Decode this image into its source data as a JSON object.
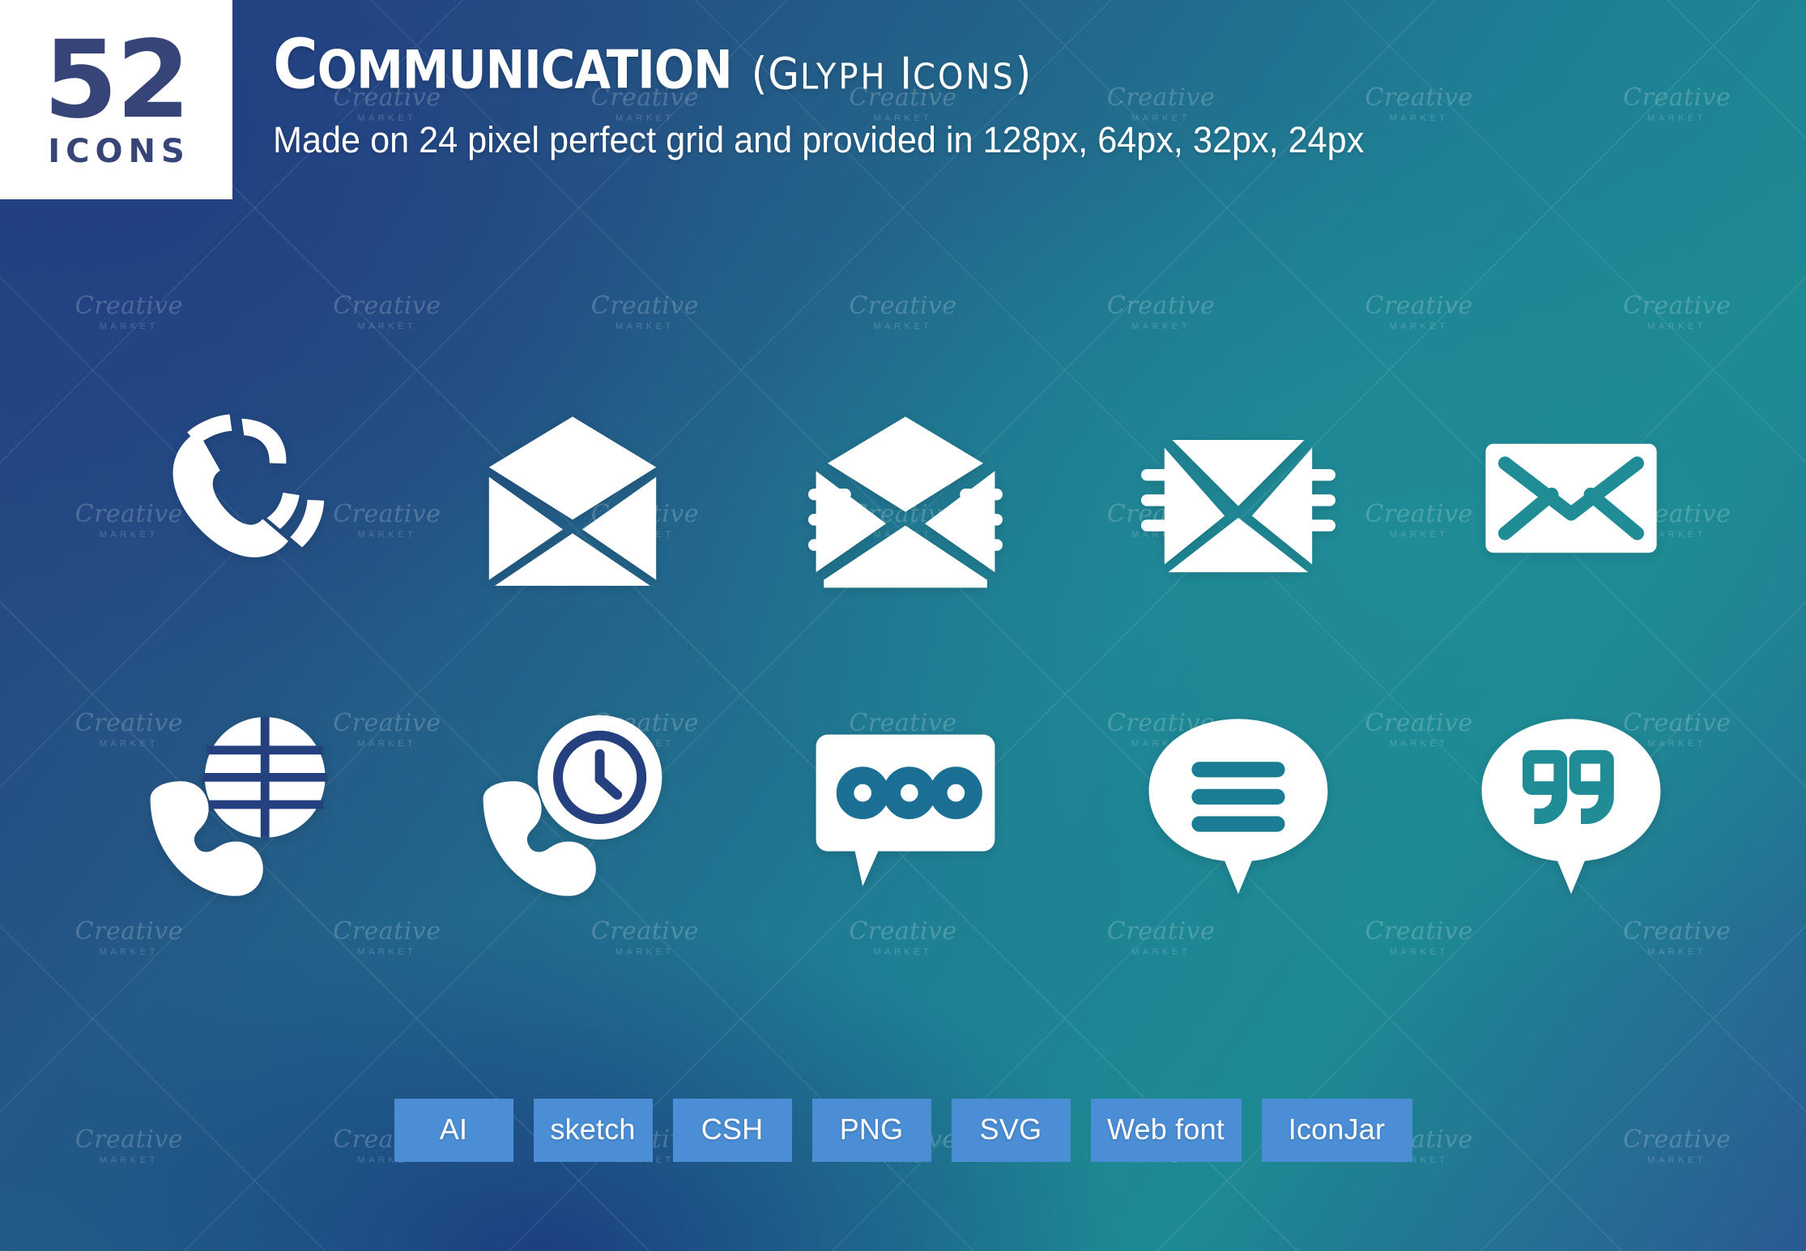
{
  "badge": {
    "count": "52",
    "label": "ICONS"
  },
  "header": {
    "title_lead": "C",
    "title_rest": "OMMUNICATION",
    "title_paren_open": "(",
    "title_glyph_lead": "G",
    "title_glyph_rest": "LYPH",
    "title_icons_lead": "I",
    "title_icons_rest": "CONS",
    "title_paren_close": ")",
    "title_full": "Communication (Glyph Icons)",
    "subtitle": "Made on 24 pixel perfect grid and provided in 128px, 64px, 32px, 24px"
  },
  "watermark": {
    "top": "Creative",
    "bottom": "MARKET"
  },
  "colors": {
    "badge_text": "#374477",
    "badge_bg": "#ffffff",
    "icon_fill": "#ffffff",
    "format_chip": "#4b8ed6",
    "bg_blue": "#24407f",
    "bg_teal": "#1f8c96"
  },
  "icons": [
    {
      "name": "phone-handset-icon",
      "label": "Phone call"
    },
    {
      "name": "envelope-open-icon",
      "label": "Open envelope"
    },
    {
      "name": "envelope-open-lines-icon",
      "label": "Open envelope with message lines"
    },
    {
      "name": "envelope-closed-lines-icon",
      "label": "Closed envelope with message lines"
    },
    {
      "name": "envelope-closed-icon",
      "label": "Closed envelope"
    },
    {
      "name": "phone-globe-icon",
      "label": "International call"
    },
    {
      "name": "phone-clock-icon",
      "label": "Call time"
    },
    {
      "name": "chat-bubble-dots-icon",
      "label": "Chat typing bubble"
    },
    {
      "name": "chat-bubble-lines-icon",
      "label": "Chat message bubble"
    },
    {
      "name": "chat-bubble-quote-icon",
      "label": "Quote bubble"
    }
  ],
  "formats": [
    {
      "label": "AI",
      "wide": false
    },
    {
      "label": "sketch",
      "wide": false
    },
    {
      "label": "CSH",
      "wide": false
    },
    {
      "label": "PNG",
      "wide": false
    },
    {
      "label": "SVG",
      "wide": false
    },
    {
      "label": "Web font",
      "wide": true
    },
    {
      "label": "IconJar",
      "wide": true
    }
  ]
}
